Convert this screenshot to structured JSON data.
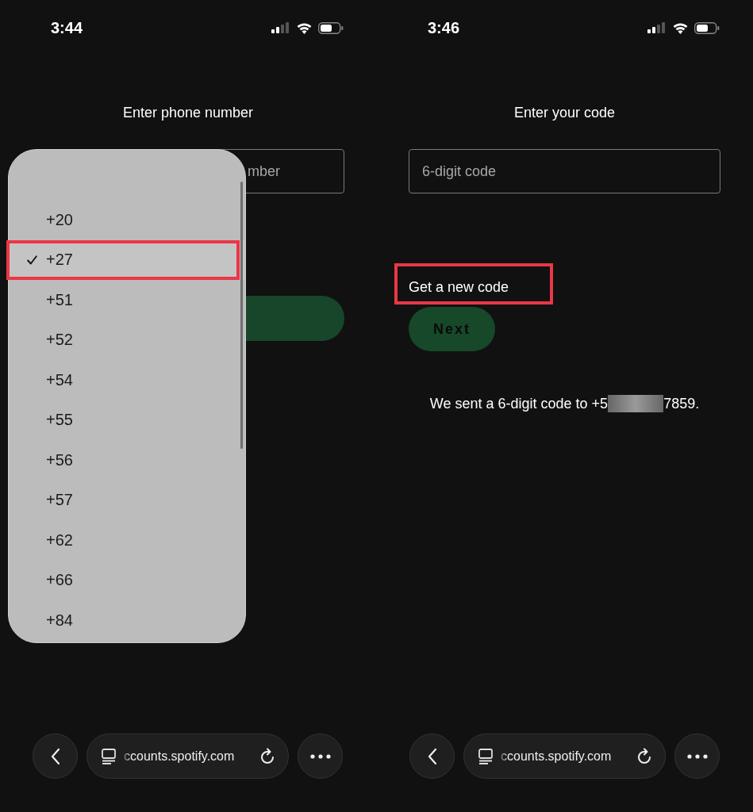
{
  "left_screen": {
    "status_bar": {
      "time": "3:44"
    },
    "title": "Enter phone number",
    "phone_field": {
      "placeholder": "mber"
    },
    "country_code_menu": {
      "items": [
        {
          "label": "+20",
          "selected": false
        },
        {
          "label": "+27",
          "selected": true
        },
        {
          "label": "+51",
          "selected": false
        },
        {
          "label": "+52",
          "selected": false
        },
        {
          "label": "+54",
          "selected": false
        },
        {
          "label": "+55",
          "selected": false
        },
        {
          "label": "+56",
          "selected": false
        },
        {
          "label": "+57",
          "selected": false
        },
        {
          "label": "+62",
          "selected": false
        },
        {
          "label": "+66",
          "selected": false
        },
        {
          "label": "+84",
          "selected": false
        }
      ]
    },
    "browser_bar": {
      "url": "ccounts.spotify.com"
    }
  },
  "right_screen": {
    "status_bar": {
      "time": "3:46"
    },
    "title": "Enter your code",
    "code_field": {
      "placeholder": "6-digit code"
    },
    "resend_link": "Get a new code",
    "next_button": "Next",
    "message_start": "We sent a 6-digit code to +5",
    "message_end": "7859.",
    "browser_bar": {
      "url": "ccounts.spotify.com"
    }
  }
}
